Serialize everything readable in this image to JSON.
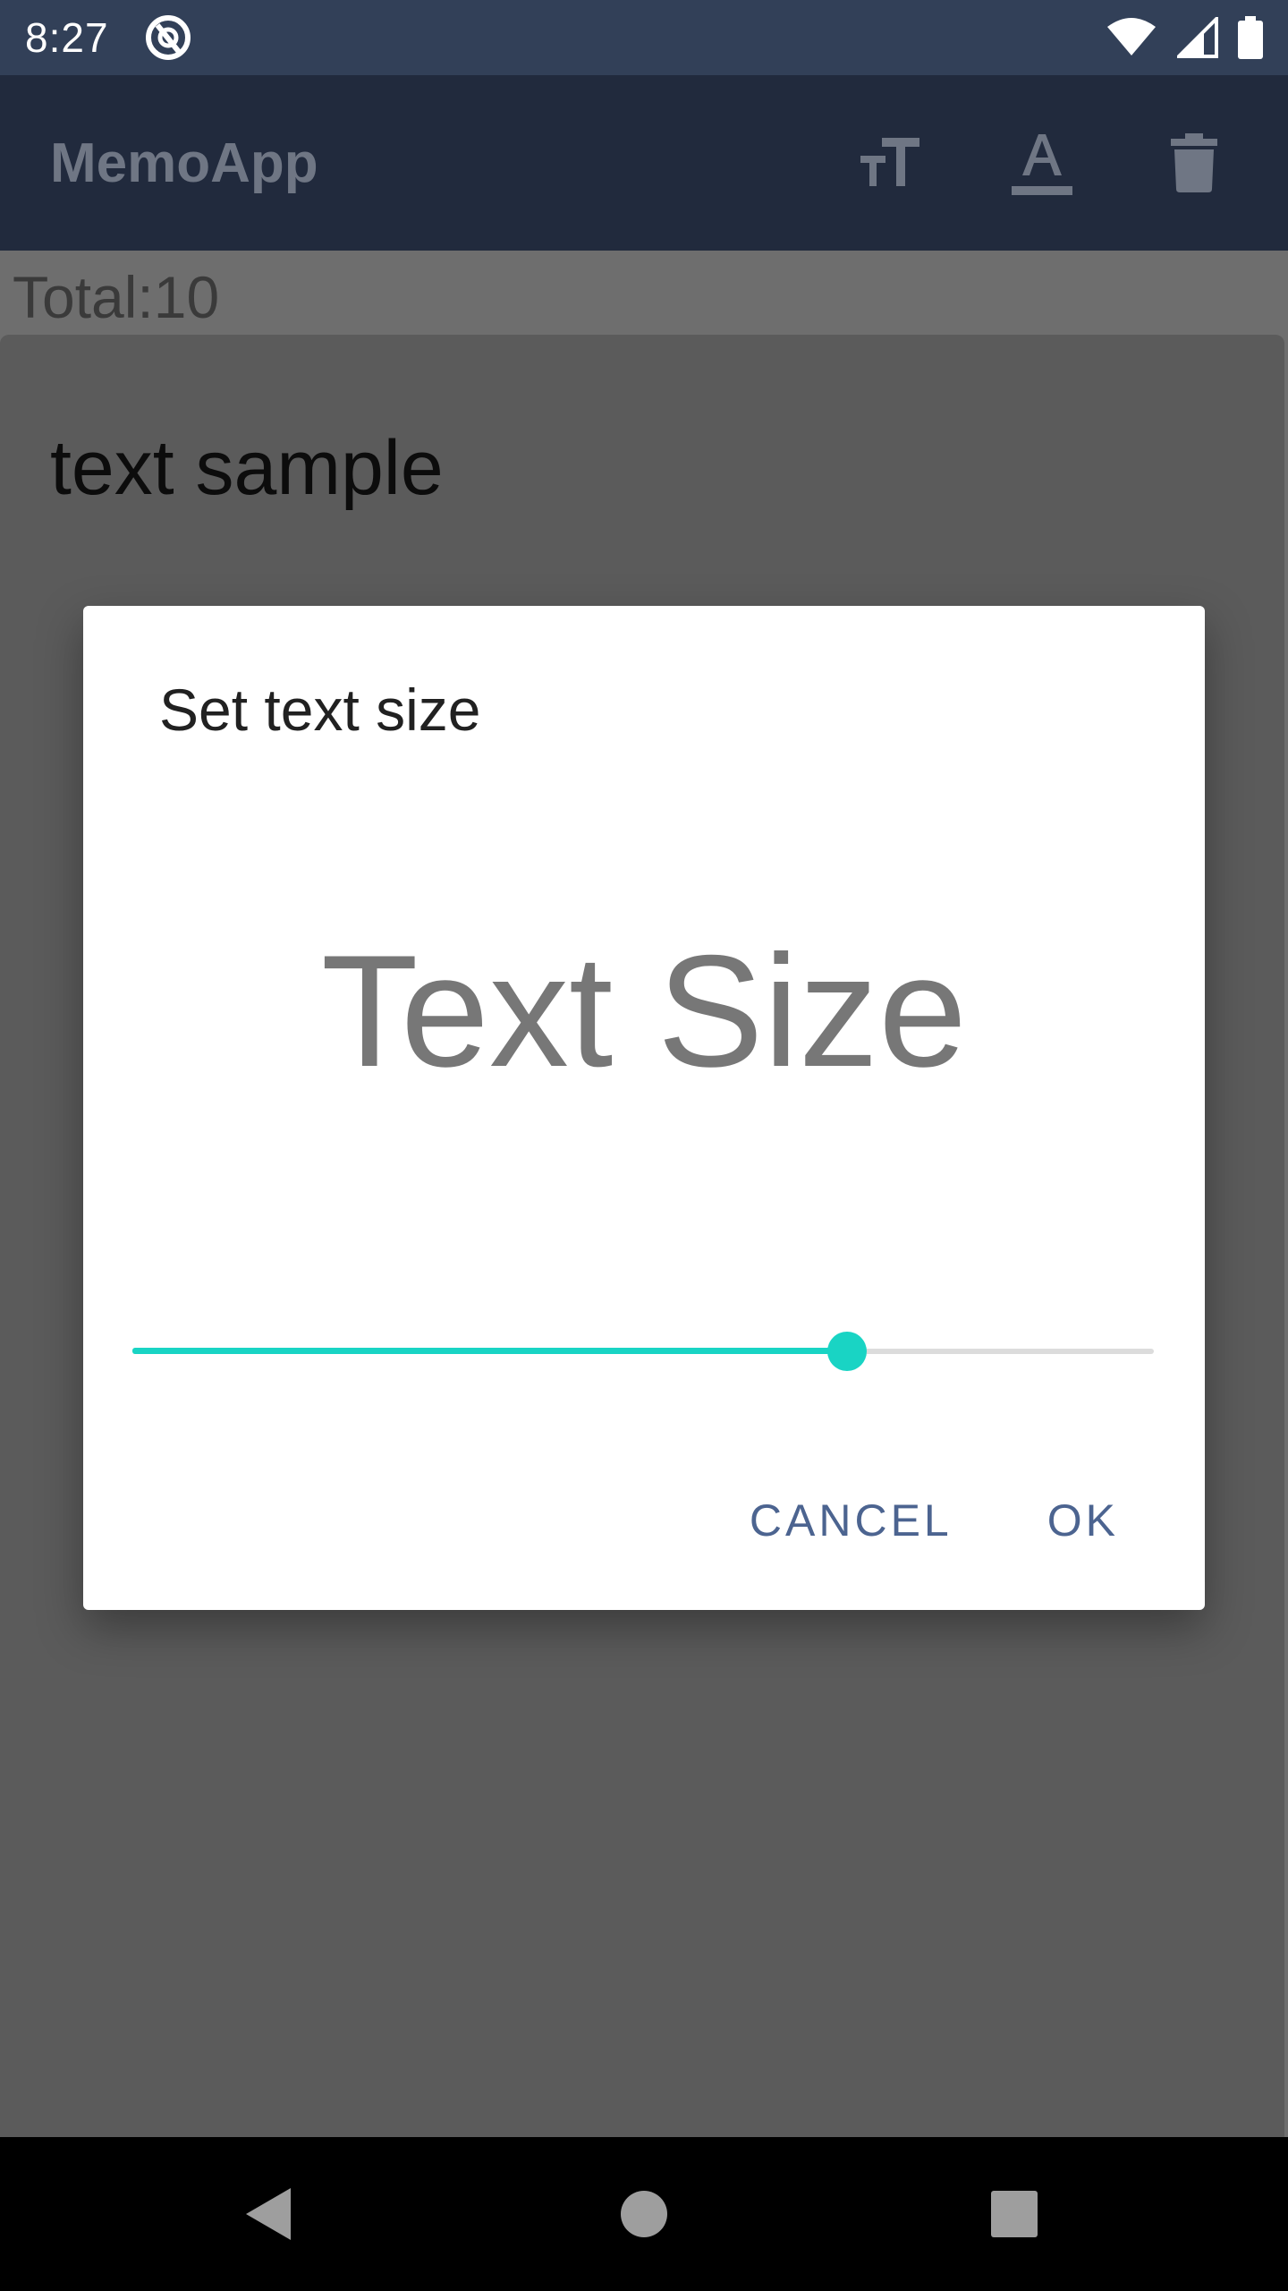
{
  "status_bar": {
    "time": "8:27",
    "icons": [
      "app-notification-icon",
      "wifi-icon",
      "signal-icon",
      "battery-icon"
    ]
  },
  "app_bar": {
    "title": "MemoApp",
    "actions": [
      "text-size-icon",
      "text-color-icon",
      "delete-icon"
    ]
  },
  "content": {
    "total_label": "Total:10",
    "memo_text": "text sample"
  },
  "dialog": {
    "title": "Set text size",
    "preview_text": "Text Size",
    "slider_value_fraction": 0.7,
    "cancel_label": "CANCEL",
    "ok_label": "OK"
  },
  "colors": {
    "accent": "#19d4c4",
    "app_bar": "#212a3d",
    "status_bar": "#324058",
    "button_text": "#4c6490"
  },
  "nav_bar": {
    "icons": [
      "back-icon",
      "home-icon",
      "recents-icon"
    ]
  }
}
